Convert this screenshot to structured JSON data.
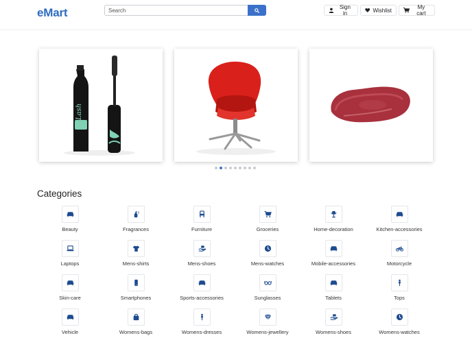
{
  "header": {
    "logo": "eMart",
    "search_placeholder": "Search",
    "signin_label": "Sign in",
    "wishlist_label": "Wishlist",
    "cart_label": "My cart"
  },
  "colors": {
    "brand": "#2d6cc0",
    "accent": "#3b71ca",
    "icon": "#1d4b8f"
  },
  "carousel": {
    "slides": [
      {
        "icon": "mascara-product-image"
      },
      {
        "icon": "red-chair-product-image"
      },
      {
        "icon": "raw-steak-product-image"
      }
    ],
    "dot_count": 9,
    "active_dot": 1
  },
  "categories": {
    "title": "Categories",
    "items": [
      {
        "label": "Beauty",
        "icon": "couch-icon"
      },
      {
        "label": "Fragrances",
        "icon": "spray-bottle-icon"
      },
      {
        "label": "Furniture",
        "icon": "chair-icon"
      },
      {
        "label": "Groceries",
        "icon": "cart-icon"
      },
      {
        "label": "Home-decoration",
        "icon": "lamp-icon"
      },
      {
        "label": "Kitchen-accessories",
        "icon": "couch-icon"
      },
      {
        "label": "Laptops",
        "icon": "laptop-icon"
      },
      {
        "label": "Mens-shirts",
        "icon": "shirt-icon"
      },
      {
        "label": "Mens-shoes",
        "icon": "hand-holding-icon"
      },
      {
        "label": "Mens-watches",
        "icon": "clock-icon"
      },
      {
        "label": "Mobile-accessories",
        "icon": "couch-icon"
      },
      {
        "label": "Motorcycle",
        "icon": "motorcycle-icon"
      },
      {
        "label": "Skin-care",
        "icon": "couch-icon"
      },
      {
        "label": "Smartphones",
        "icon": "phone-icon"
      },
      {
        "label": "Sports-accessories",
        "icon": "couch-icon"
      },
      {
        "label": "Sunglasses",
        "icon": "glasses-icon"
      },
      {
        "label": "Tablets",
        "icon": "couch-icon"
      },
      {
        "label": "Tops",
        "icon": "person-icon"
      },
      {
        "label": "Vehicle",
        "icon": "couch-icon"
      },
      {
        "label": "Womens-bags",
        "icon": "bag-icon"
      },
      {
        "label": "Womens-dresses",
        "icon": "person-icon"
      },
      {
        "label": "Womens-jewellery",
        "icon": "gem-icon"
      },
      {
        "label": "Womens-shoes",
        "icon": "hand-holding-icon"
      },
      {
        "label": "Womens-watches",
        "icon": "clock-icon"
      }
    ]
  }
}
